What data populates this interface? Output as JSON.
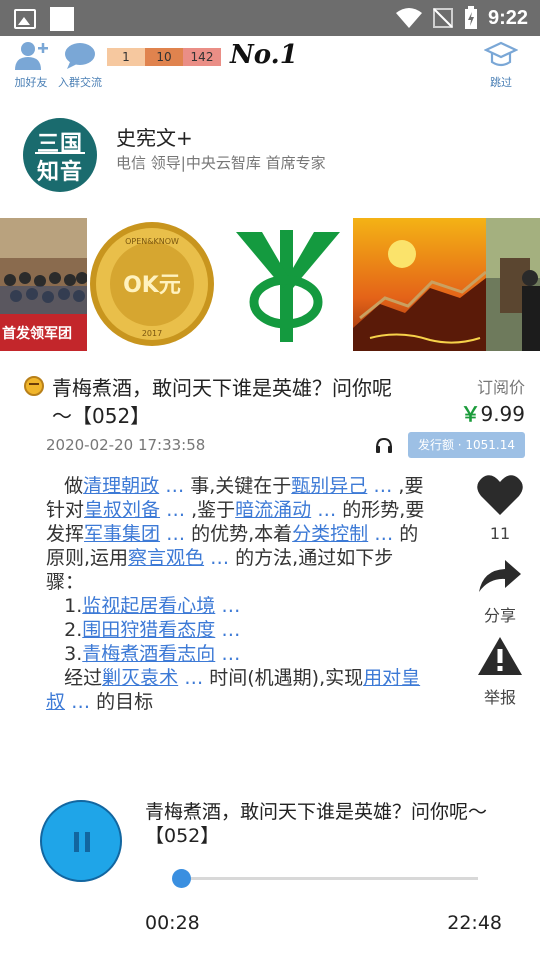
{
  "status_bar": {
    "time": "9:22"
  },
  "topbar": {
    "add_friend": "加好友",
    "join_group": "入群交流",
    "skip": "跳过",
    "levels": [
      "1",
      "10",
      "142"
    ],
    "rank": "No.1"
  },
  "author": {
    "avatar_line1": "三国",
    "avatar_line2": "知音",
    "name": "史宪文+",
    "title": "电信 领导|中央云智库 首席专家"
  },
  "banner": {
    "photo1_caption": "首发领军团",
    "coin_ring": "OPEN&KNOW",
    "coin_center": "OK元",
    "coin_year": "2017"
  },
  "article": {
    "title": "青梅煮酒，敢问天下谁是英雄？问你呢～【052】",
    "price_label": "订阅价",
    "price_symbol": "￥",
    "price_value": "9.99",
    "date": "2020-02-20 17:33:58",
    "issue_label": "发行额 · 1051.14"
  },
  "content": {
    "p1_start": "做",
    "link1": "清理朝政",
    "t1": "事,关键在于",
    "link2": "甄别异己",
    "t2": ",要针对",
    "link3": "皇叔刘备",
    "t3": ",鉴于",
    "link4": "暗流涌动",
    "t4": "的形势,要发挥",
    "link5": "军事集团",
    "t5": "的优势,本着",
    "link6": "分类控制",
    "t6": "的原则,运用",
    "link7": "察言观色",
    "t7": "的方法,通过如下步骤：",
    "step1_no": "1.",
    "step1": "监视起居看心境",
    "step2_no": "2.",
    "step2": "围田狩猎看态度",
    "step3_no": "3.",
    "step3": "青梅煮酒看志向",
    "p2_start": "经过",
    "link8": "剿灭袁术",
    "t8": "时间(机遇期),实现",
    "link9": "用对皇叔",
    "t9": "的目标",
    "ellipsis": "…"
  },
  "actions": {
    "like_count": "11",
    "share": "分享",
    "report": "举报"
  },
  "player": {
    "title": "青梅煮酒，敢问天下谁是英雄？问你呢～【052】",
    "current_time": "00:28",
    "total_time": "22:48",
    "progress": 0.02
  },
  "colors": {
    "link": "#3d7ad6",
    "accent_blue": "#1fa5e8",
    "price_green": "#1a9b3a",
    "issue_badge": "#9dc0e5"
  }
}
